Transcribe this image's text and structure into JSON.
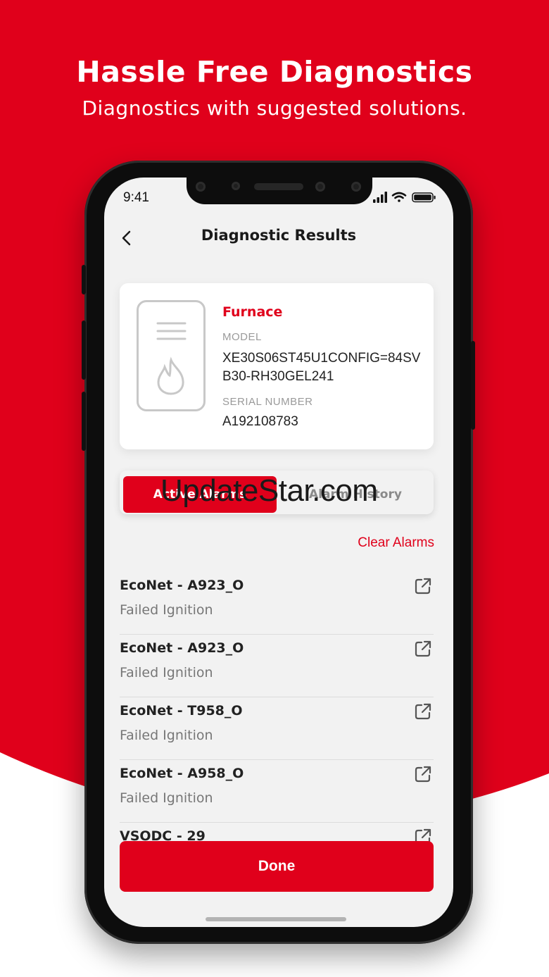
{
  "promo": {
    "headline": "Hassle Free Diagnostics",
    "subheadline": "Diagnostics with suggested solutions."
  },
  "status_bar": {
    "time": "9:41",
    "icons": [
      "signal-icon",
      "wifi-icon",
      "battery-icon"
    ]
  },
  "nav": {
    "back_icon": "chevron-left-icon",
    "title": "Diagnostic Results"
  },
  "device": {
    "icon": "furnace-icon",
    "type": "Furnace",
    "model_label": "MODEL",
    "model_value": "XE30S06ST45U1CONFIG=84SVB30-RH30GEL241",
    "serial_label": "SERIAL NUMBER",
    "serial_value": "A192108783"
  },
  "tabs": [
    {
      "label": "Active Alarms",
      "active": true
    },
    {
      "label": "Alarm History",
      "active": false
    }
  ],
  "watermark": "UpdateStar.com",
  "clear_alarms_label": "Clear Alarms",
  "alarms": [
    {
      "code": "EcoNet - A923_O",
      "description": "Failed Ignition"
    },
    {
      "code": "EcoNet - A923_O",
      "description": "Failed Ignition"
    },
    {
      "code": "EcoNet - T958_O",
      "description": "Failed Ignition"
    },
    {
      "code": "EcoNet - A958_O",
      "description": "Failed Ignition"
    },
    {
      "code": "VSODC - 29",
      "description": ""
    }
  ],
  "done_label": "Done",
  "colors": {
    "brand_red": "#e0001b",
    "background_white": "#ffffff",
    "screen_bg": "#f2f2f2"
  }
}
